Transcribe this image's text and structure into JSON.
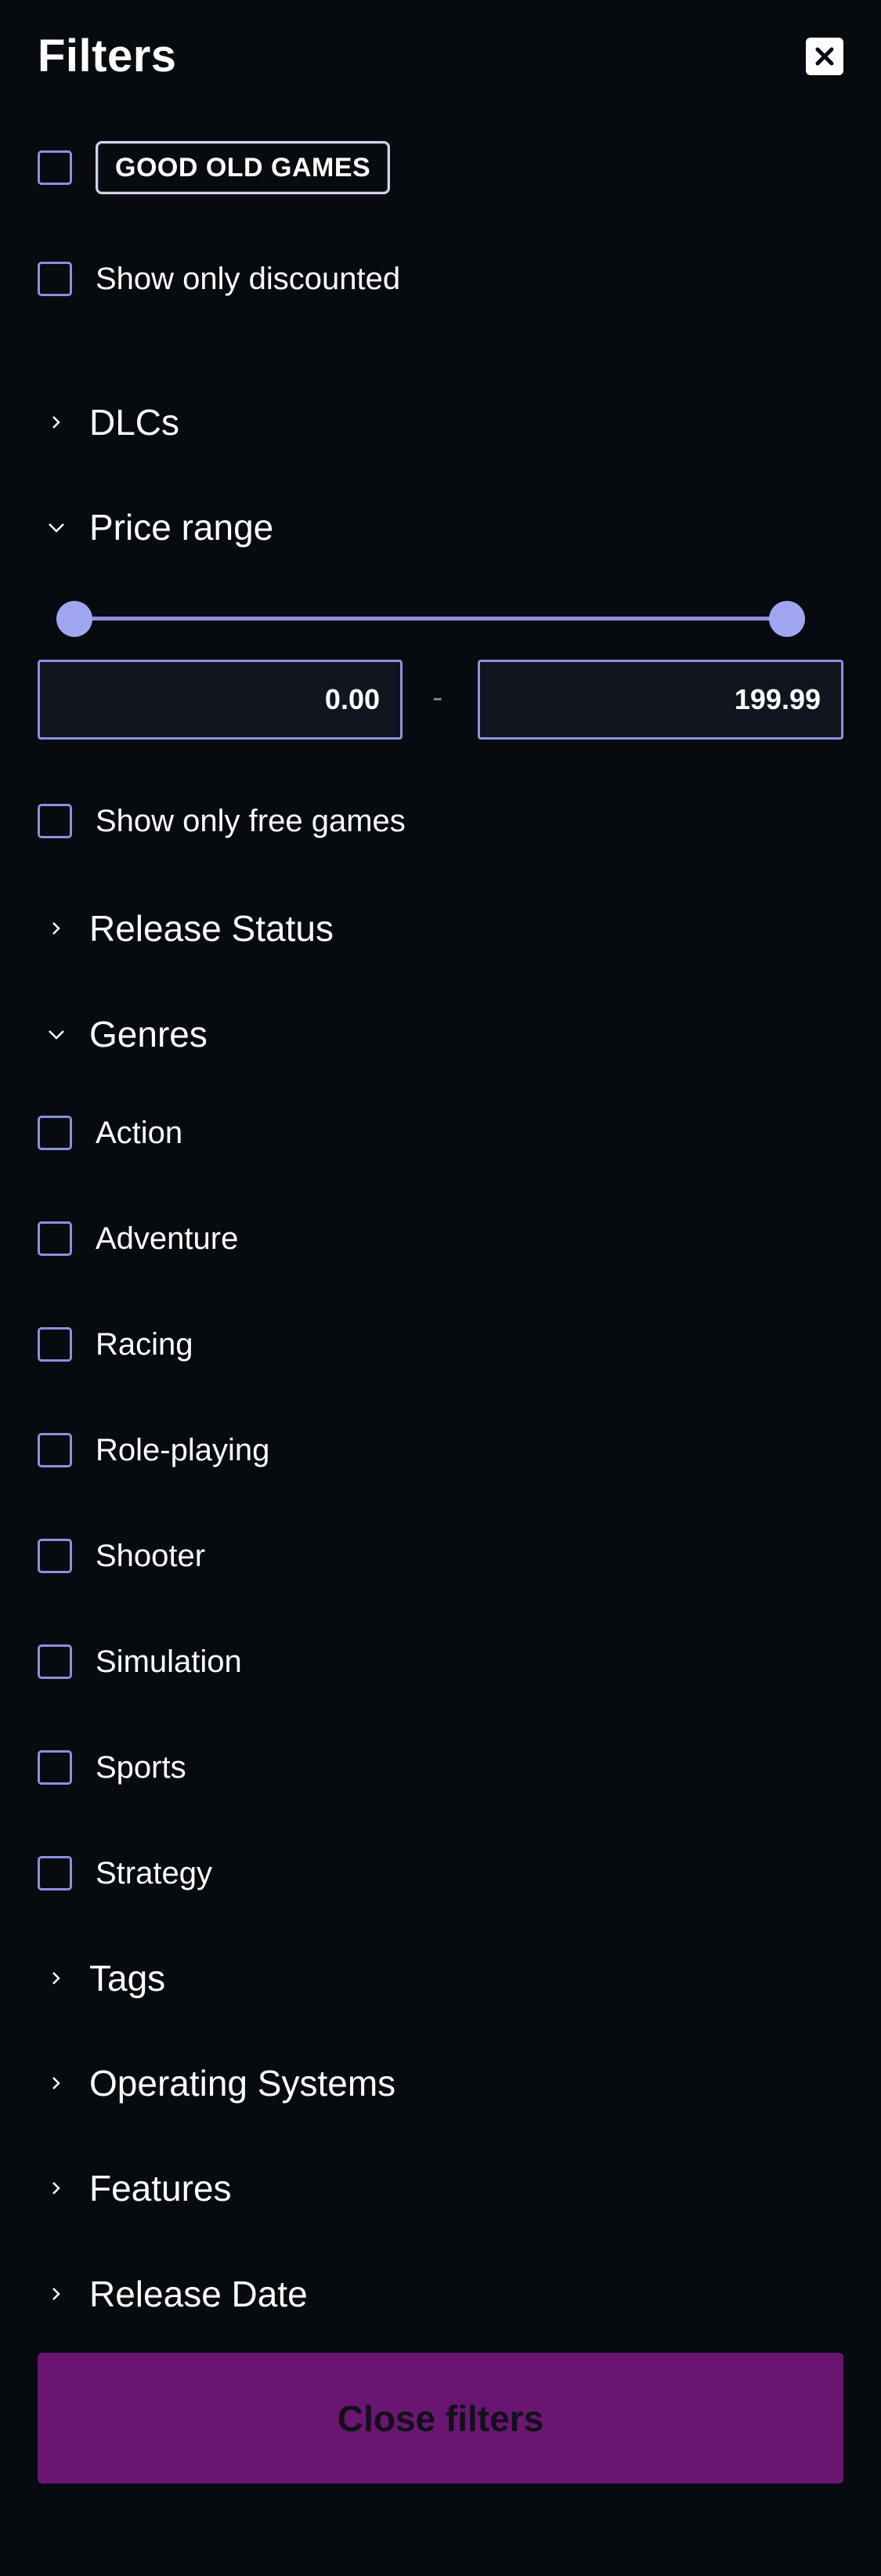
{
  "header": {
    "title": "Filters",
    "close_icon": "close-x-icon"
  },
  "toggles": {
    "gog_label": "GOOD OLD GAMES",
    "discounted_label": "Show only discounted",
    "free_label": "Show only free games"
  },
  "sections": {
    "dlcs": {
      "label": "DLCs",
      "expanded": false
    },
    "price": {
      "label": "Price range",
      "expanded": true
    },
    "release_status": {
      "label": "Release Status",
      "expanded": false
    },
    "genres": {
      "label": "Genres",
      "expanded": true
    },
    "tags": {
      "label": "Tags",
      "expanded": false
    },
    "os": {
      "label": "Operating Systems",
      "expanded": false
    },
    "features": {
      "label": "Features",
      "expanded": false
    },
    "release_date": {
      "label": "Release Date",
      "expanded": false
    }
  },
  "price_range": {
    "min_value": "0.00",
    "max_value": "199.99",
    "separator": "-"
  },
  "genres": [
    {
      "label": "Action",
      "checked": false
    },
    {
      "label": "Adventure",
      "checked": false
    },
    {
      "label": "Racing",
      "checked": false
    },
    {
      "label": "Role-playing",
      "checked": false
    },
    {
      "label": "Shooter",
      "checked": false
    },
    {
      "label": "Simulation",
      "checked": false
    },
    {
      "label": "Sports",
      "checked": false
    },
    {
      "label": "Strategy",
      "checked": false
    }
  ],
  "footer": {
    "close_button_label": "Close filters"
  },
  "colors": {
    "background": "#070a0f",
    "accent": "#8b90e0",
    "button": "#6a1571"
  }
}
